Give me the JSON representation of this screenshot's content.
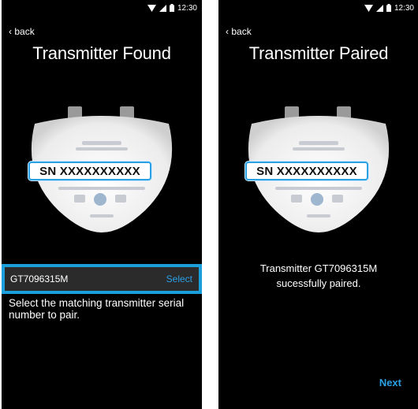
{
  "colors": {
    "accent": "#2aa0e6",
    "background": "#000000",
    "row_background": "#2b2b2b"
  },
  "left_screen": {
    "status_bar": {
      "time": "12:30",
      "icons": [
        "wifi-icon",
        "signal-icon",
        "battery-icon"
      ]
    },
    "back_label": "back",
    "title": "Transmitter Found",
    "serial_label": "SN XXXXXXXXXX",
    "device_row": {
      "serial": "GT7096315M",
      "action": "Select"
    },
    "instructions": "Select the matching transmitter serial number to pair."
  },
  "right_screen": {
    "status_bar": {
      "time": "12:30",
      "icons": [
        "wifi-icon",
        "signal-icon",
        "battery-icon"
      ]
    },
    "back_label": "back",
    "title": "Transmitter Paired",
    "serial_label": "SN XXXXXXXXXX",
    "message_line1": "Transmitter GT7096315M",
    "message_line2": "sucessfully paired.",
    "next_label": "Next"
  }
}
